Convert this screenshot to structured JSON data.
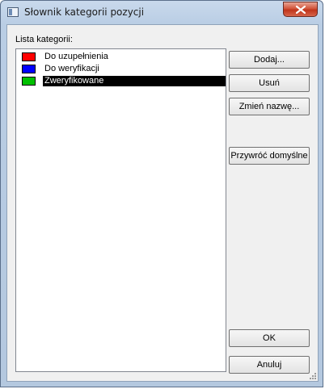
{
  "window": {
    "title": "Słownik kategorii pozycji"
  },
  "list": {
    "label": "Lista kategorii:",
    "items": [
      {
        "label": "Do uzupełnienia",
        "color": "#ff0000",
        "selected": false
      },
      {
        "label": "Do weryfikacji",
        "color": "#0000ff",
        "selected": false
      },
      {
        "label": "Zweryfikowane",
        "color": "#00c000",
        "selected": true
      }
    ]
  },
  "buttons": {
    "add": "Dodaj...",
    "remove": "Usuń",
    "rename": "Zmień nazwę...",
    "restore_defaults": "Przywróć domyślne",
    "ok": "OK",
    "cancel": "Anuluj"
  },
  "icons": {
    "app": "window-app-icon",
    "close": "close-icon",
    "resize": "resize-grip-icon"
  }
}
